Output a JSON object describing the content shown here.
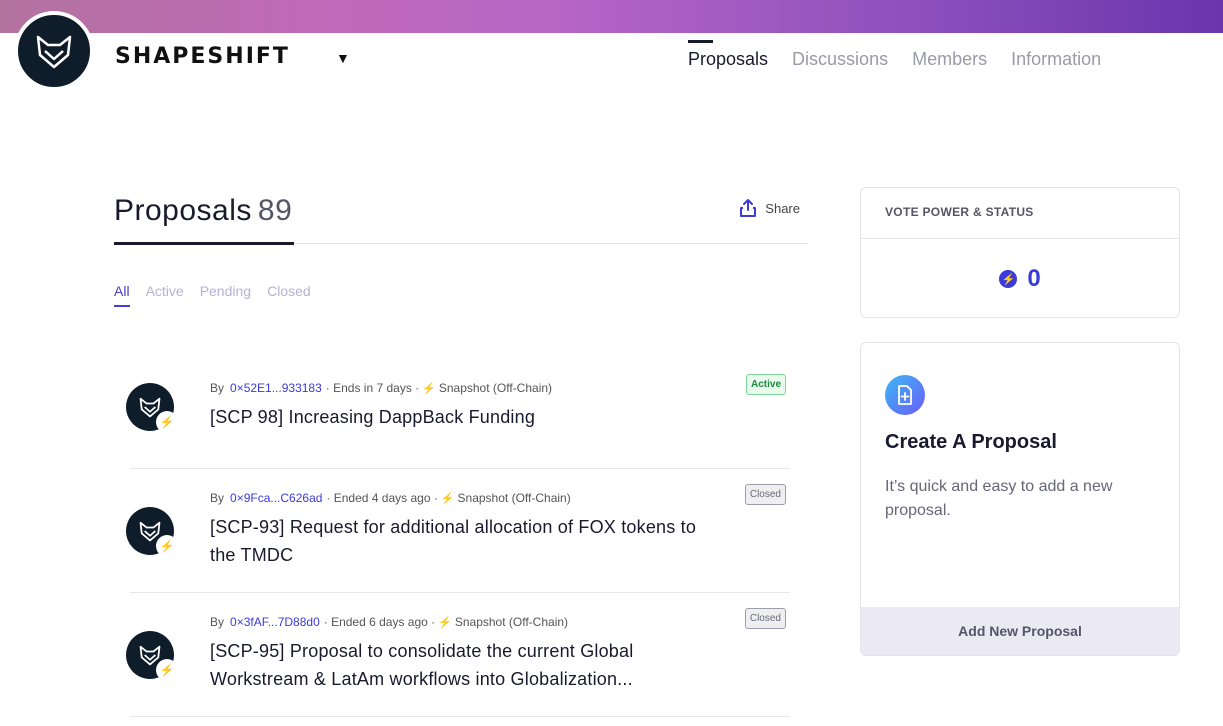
{
  "header": {
    "brand": "SHAPESHIFT",
    "brand_caret": "▼",
    "nav": [
      "Proposals",
      "Discussions",
      "Members",
      "Information"
    ]
  },
  "page": {
    "title": "Proposals",
    "count": "89",
    "share_label": "Share",
    "filters": [
      "All",
      "Active",
      "Pending",
      "Closed"
    ]
  },
  "proposals": [
    {
      "by": "By",
      "address": "0×52E1...933183",
      "time": "· Ends in 7 days ·",
      "platform": "Snapshot (Off-Chain)",
      "title": "[SCP 98] Increasing DappBack Funding",
      "status": "Active"
    },
    {
      "by": "By",
      "address": "0×9Fca...C626ad",
      "time": "· Ended 4 days ago ·",
      "platform": "Snapshot (Off-Chain)",
      "title": "[SCP-93] Request for additional allocation of FOX tokens to the TMDC",
      "status": "Closed"
    },
    {
      "by": "By",
      "address": "0×3fAF...7D88d0",
      "time": "· Ended 6 days ago ·",
      "platform": "Snapshot (Off-Chain)",
      "title": "[SCP-95] Proposal to consolidate the current Global Workstream & LatAm workflows into Globalization...",
      "status": "Closed"
    }
  ],
  "sidebar": {
    "vote_power": {
      "header": "VOTE POWER & STATUS",
      "value": "0",
      "icon": "lightning-icon"
    },
    "create": {
      "title": "Create A Proposal",
      "description": "It’s quick and easy to add a new proposal.",
      "button": "Add New Proposal",
      "icon": "new-document-icon"
    }
  },
  "colors": {
    "accent": "#3b3bd9",
    "active_badge": "#1f8a3b",
    "closed_badge": "#6a6a78",
    "banner_start": "#b3739f",
    "banner_end": "#6a35ad"
  }
}
